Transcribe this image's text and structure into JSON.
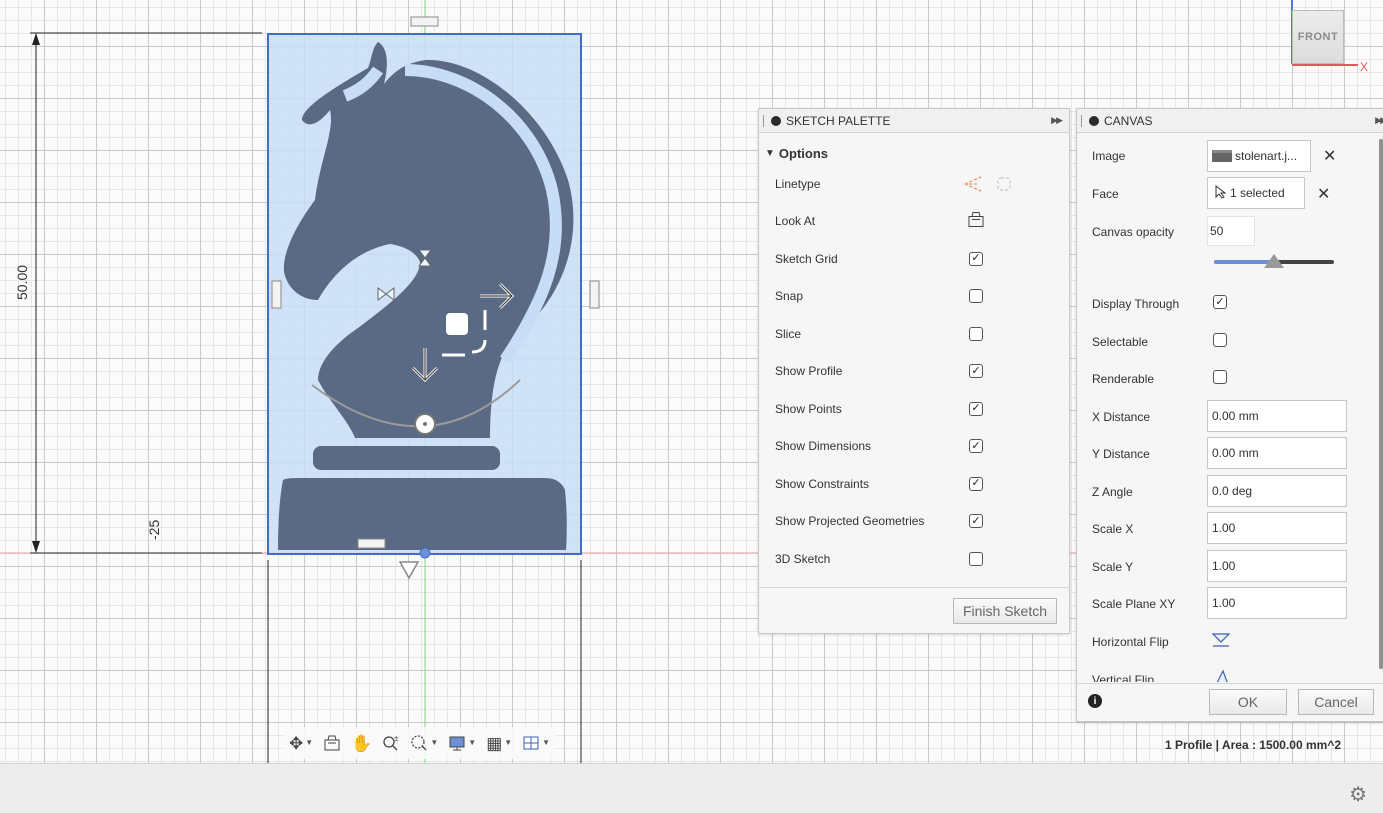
{
  "viewport": {
    "dimension_vertical": "50.00",
    "dimension_horizontal": "-25"
  },
  "viewcube": {
    "face": "FRONT",
    "x_axis": "X"
  },
  "sketch_palette": {
    "title": "SKETCH PALETTE",
    "section": "Options",
    "rows": [
      {
        "label": "Linetype",
        "control": "linetype-icons"
      },
      {
        "label": "Look At",
        "control": "look-at-icon"
      },
      {
        "label": "Sketch Grid",
        "checked": true
      },
      {
        "label": "Snap",
        "checked": false
      },
      {
        "label": "Slice",
        "checked": false
      },
      {
        "label": "Show Profile",
        "checked": true
      },
      {
        "label": "Show Points",
        "checked": true
      },
      {
        "label": "Show Dimensions",
        "checked": true
      },
      {
        "label": "Show Constraints",
        "checked": true
      },
      {
        "label": "Show Projected Geometries",
        "checked": true
      },
      {
        "label": "3D Sketch",
        "checked": false
      }
    ],
    "finish_button": "Finish Sketch"
  },
  "canvas_panel": {
    "title": "CANVAS",
    "image_label": "Image",
    "image_value": "stolenart.j...",
    "face_label": "Face",
    "face_value": "1 selected",
    "opacity_label": "Canvas opacity",
    "opacity_value": "50",
    "opacity_level": 0.5,
    "display_through_label": "Display Through",
    "display_through": true,
    "selectable_label": "Selectable",
    "selectable": false,
    "renderable_label": "Renderable",
    "renderable": false,
    "x_distance_label": "X Distance",
    "x_distance": "0.00 mm",
    "y_distance_label": "Y Distance",
    "y_distance": "0.00 mm",
    "z_angle_label": "Z Angle",
    "z_angle": "0.0 deg",
    "scale_x_label": "Scale X",
    "scale_x": "1.00",
    "scale_y_label": "Scale Y",
    "scale_y": "1.00",
    "scale_plane_label": "Scale Plane XY",
    "scale_plane": "1.00",
    "hflip_label": "Horizontal Flip",
    "vflip_label": "Vertical Flip",
    "ok_label": "OK",
    "cancel_label": "Cancel"
  },
  "status": {
    "text": "1 Profile | Area : 1500.00 mm^2"
  },
  "colors": {
    "selection_fill": "#c7ddf7",
    "selection_border": "#3f6fc4",
    "figure": "#5a6a84",
    "accent_blue": "#6d8fd6"
  }
}
